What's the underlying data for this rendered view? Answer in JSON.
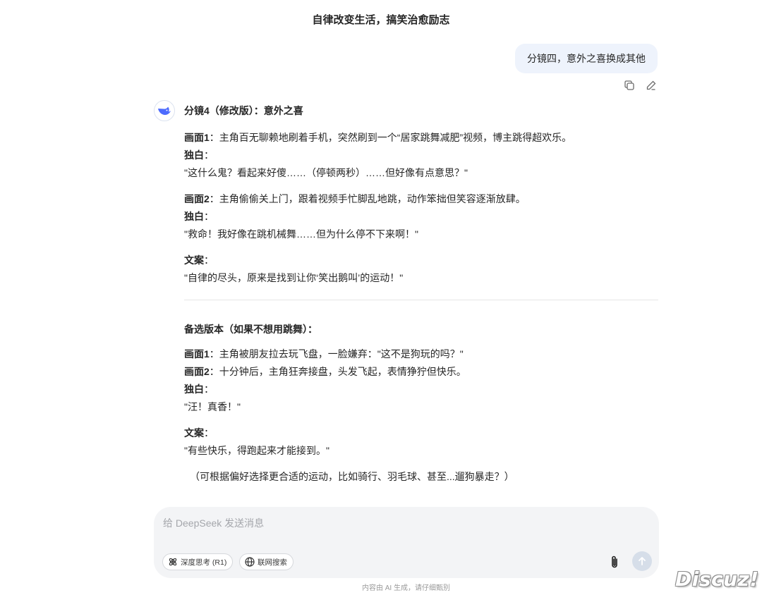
{
  "conversation": {
    "title": "自律改变生活，搞笑治愈励志"
  },
  "user_message": {
    "text": "分镜四，意外之喜换成其他"
  },
  "message_actions": {
    "copy_icon": "copy-icon",
    "edit_icon": "edit-icon"
  },
  "assistant": {
    "avatar_icon": "deepseek-whale-icon",
    "heading": "分镜4（修改版）：意外之喜",
    "blocks": [
      {
        "label": "画面1",
        "text": "：主角百无聊赖地刷着手机，突然刷到一个“居家跳舞减肥”视频，博主跳得超欢乐。"
      },
      {
        "label": "独白",
        "text": "："
      },
      {
        "text": "\"这什么鬼？看起来好傻……（停顿两秒）……但好像有点意思？\""
      },
      {
        "label": "画面2",
        "text": "：主角偷偷关上门，跟着视频手忙脚乱地跳，动作笨拙但笑容逐渐放肆。"
      },
      {
        "label": "独白",
        "text": "："
      },
      {
        "text": "\"救命！我好像在跳机械舞……但为什么停不下来啊！\""
      },
      {
        "label": "文案",
        "text": "："
      },
      {
        "text": "\"自律的尽头，原来是找到让你‘笑出鹅叫’的运动！\""
      }
    ],
    "alt_heading": "备选版本（如果不想用跳舞）：",
    "alt_blocks": [
      {
        "label": "画面1",
        "text": "：主角被朋友拉去玩飞盘，一脸嫌弃：\"这不是狗玩的吗？\""
      },
      {
        "label": "画面2",
        "text": "：十分钟后，主角狂奔接盘，头发飞起，表情狰狞但快乐。"
      },
      {
        "label": "独白",
        "text": "："
      },
      {
        "text": "\"汪！真香！\""
      },
      {
        "label": "文案",
        "text": "："
      },
      {
        "text": "\"有些快乐，得跑起来才能接到。\""
      }
    ],
    "note": "（可根据偏好选择更合适的运动，比如骑行、羽毛球、甚至...遛狗暴走？）"
  },
  "composer": {
    "placeholder": "给 DeepSeek 发送消息",
    "deep_think_label": "深度思考 (R1)",
    "web_search_label": "联网搜索",
    "attach_icon": "paperclip-icon",
    "send_icon": "arrow-up-icon"
  },
  "footer": {
    "disclaimer": "内容由 AI 生成，请仔细甄别"
  },
  "watermark": {
    "text": "Discuz!"
  },
  "colors": {
    "user_bubble": "#eef3fc",
    "accent": "#4d6bfe",
    "send_disabled": "#d6dee9"
  }
}
